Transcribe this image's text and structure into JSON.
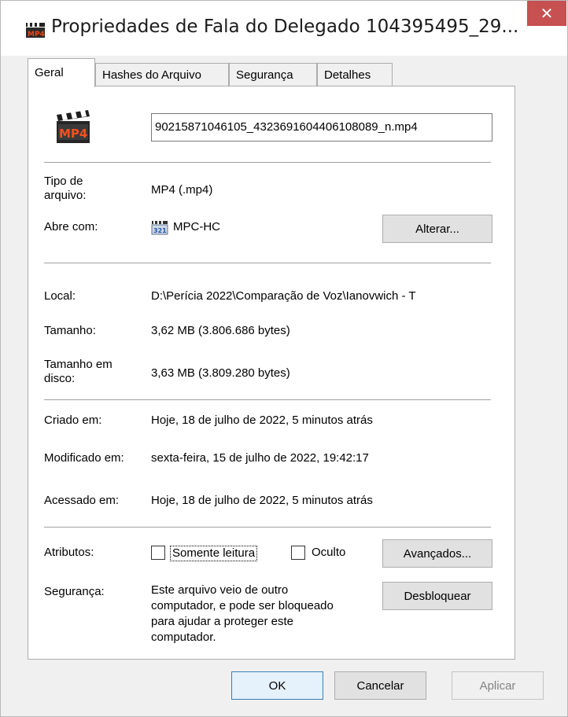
{
  "window": {
    "title": "Propriedades de Fala do Delegado 104395495_29...",
    "close_glyph": "✕"
  },
  "tabs": [
    {
      "label": "Geral",
      "active": true
    },
    {
      "label": "Hashes do Arquivo",
      "active": false
    },
    {
      "label": "Segurança",
      "active": false
    },
    {
      "label": "Detalhes",
      "active": false
    }
  ],
  "general": {
    "file_icon": "mp4-file-icon",
    "filename": "90215871046105_4323691604406108089_n.mp4",
    "file_type_label": "Tipo de arquivo:",
    "file_type_value": "MP4 (.mp4)",
    "opens_with_label": "Abre com:",
    "opens_with_value": "MPC-HC",
    "opens_with_icon": "mpc-hc-app-icon",
    "change_button": "Alterar...",
    "location_label": "Local:",
    "location_value": "D:\\Perícia 2022\\Comparação de Voz\\Ianovwich - T",
    "size_label": "Tamanho:",
    "size_value": "3,62 MB (3.806.686 bytes)",
    "disk_size_label": "Tamanho em disco:",
    "disk_size_value": "3,63 MB (3.809.280 bytes)",
    "created_label": "Criado em:",
    "created_value": "Hoje, 18 de julho de 2022, 5 minutos atrás",
    "modified_label": "Modificado em:",
    "modified_value": "sexta-feira, 15 de julho de 2022, 19:42:17",
    "accessed_label": "Acessado em:",
    "accessed_value": "Hoje, 18 de julho de 2022, 5 minutos atrás",
    "attributes_label": "Atributos:",
    "readonly_label": "Somente leitura",
    "readonly_checked": false,
    "hidden_label": "Oculto",
    "hidden_checked": false,
    "advanced_button": "Avançados...",
    "security_label": "Segurança:",
    "security_text": "Este arquivo veio de outro computador, e pode ser bloqueado para ajudar a proteger este computador.",
    "unblock_button": "Desbloquear"
  },
  "footer": {
    "ok_button": "OK",
    "cancel_button": "Cancelar",
    "apply_button": "Aplicar"
  },
  "colors": {
    "close_button": "#c75050",
    "window_bg": "#f0f0f0",
    "panel_bg": "#ffffff"
  }
}
